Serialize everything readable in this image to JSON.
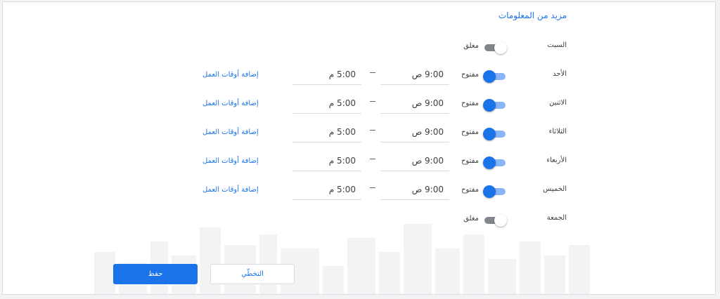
{
  "title": "مزيد من المعلومات",
  "days": [
    {
      "name": "السبت",
      "status": "مغلق",
      "open": false
    },
    {
      "name": "الأحد",
      "status": "مفتوح",
      "open": true,
      "from": "9:00 ص",
      "to": "5:00 م",
      "add_label": "إضافة أوقات العمل"
    },
    {
      "name": "الاثنين",
      "status": "مفتوح",
      "open": true,
      "from": "9:00 ص",
      "to": "5:00 م",
      "add_label": "إضافة أوقات العمل"
    },
    {
      "name": "الثلاثاء",
      "status": "مفتوح",
      "open": true,
      "from": "9:00 ص",
      "to": "5:00 م",
      "add_label": "إضافة أوقات العمل"
    },
    {
      "name": "الأربعاء",
      "status": "مفتوح",
      "open": true,
      "from": "9:00 ص",
      "to": "5:00 م",
      "add_label": "إضافة أوقات العمل"
    },
    {
      "name": "الخميس",
      "status": "مفتوح",
      "open": true,
      "from": "9:00 ص",
      "to": "5:00 م",
      "add_label": "إضافة أوقات العمل"
    },
    {
      "name": "الجمعة",
      "status": "مغلق",
      "open": false
    }
  ],
  "buttons": {
    "save": "حفظ",
    "skip": "التخطّي"
  },
  "colors": {
    "accent": "#1a73e8",
    "accent_light": "#8ab4f8",
    "off_track": "#80868b"
  }
}
